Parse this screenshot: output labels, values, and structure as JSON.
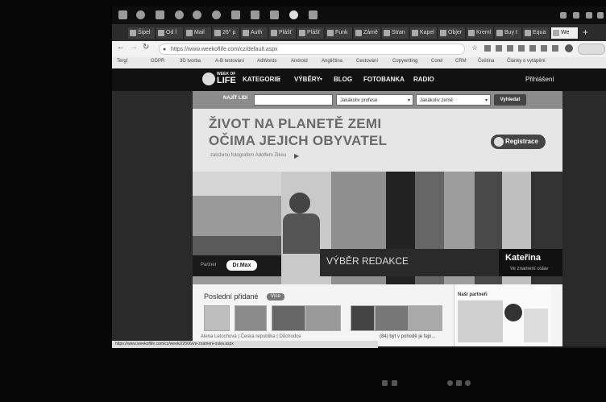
{
  "tabs": [
    "Šipel",
    "Od Í",
    "Mail",
    "26° p",
    "Auth",
    "Plášť",
    "Plášť",
    "Funk",
    "Zámě",
    "Stran",
    "Kapel",
    "Objer",
    "Kreml",
    "Buy t",
    "Equa",
    "We"
  ],
  "address": {
    "url": "https://www.weekoflife.com/cz/default.aspx"
  },
  "bookmarks": [
    "Tergl",
    "GDPR",
    "3D tvorba",
    "A-B testování",
    "AdWords",
    "Android",
    "Angličtina",
    "Cestování",
    "Copywriting",
    "Corel",
    "CRM",
    "Čeština",
    "Články o vytápění"
  ],
  "site": {
    "logo_small": "WEEK OF",
    "logo_big": "LIFE",
    "nav": [
      "KATEGORIE",
      "VÝBĚRY",
      "BLOG",
      "FOTOBANKA",
      "RADIO"
    ],
    "login": "Přihlášení",
    "search": {
      "label": "NAJÍT LIDI",
      "profession": "Jakákoliv profese",
      "country": "Jakákoliv země",
      "button": "Vyhledat"
    },
    "hero": {
      "line1": "ŽIVOT NA PLANETĚ ZEMI",
      "line2": "OČIMA JEJICH OBYVATEL",
      "founded": "založeno fotografem Adolfem Zikou",
      "register": "Registrace"
    },
    "partner_label": "Partner",
    "partner_brand": "Dr.Max",
    "editors_pick": "VÝBĚR REDAKCE",
    "person_name": "Kateřina",
    "person_sub": "Ve znamení oslav",
    "recent_title": "Poslední přidané",
    "more_label": "Více",
    "partners_title": "Naši partneři",
    "caption_left": "Alena Letochová | Česká republika | Důchodce",
    "caption_right": "(84) být v pohodě je fajn...",
    "status_url": "https://www.weekoflife.com/cz/week/22506/ve-znameni-oslav.aspx"
  }
}
